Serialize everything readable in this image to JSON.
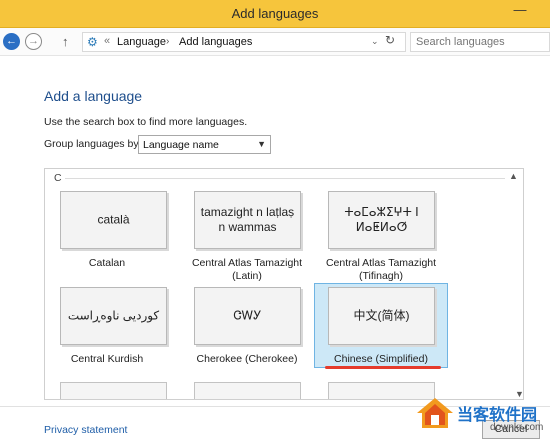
{
  "window": {
    "title": "Add languages",
    "minimize_glyph": "—"
  },
  "address_bar": {
    "back_glyph": "←",
    "forward_glyph": "→",
    "up_glyph": "↑",
    "separator": "«",
    "breadcrumbs": [
      "Language",
      "Add languages"
    ],
    "crumb_arrow": "›",
    "dropdown_glyph": "⌄",
    "refresh_glyph": "↻",
    "search_placeholder": "Search languages"
  },
  "content": {
    "heading": "Add a language",
    "hint": "Use the search box to find more languages.",
    "group_label": "Group languages by:",
    "group_value": "Language name",
    "section_letter": "C"
  },
  "languages": [
    {
      "native": "català",
      "name": "Catalan",
      "selected": false
    },
    {
      "native": "tamazight n laṭlaṣ n wammas",
      "name": "Central Atlas Tamazight (Latin)",
      "selected": false
    },
    {
      "native": "ⵜⴰⵎⴰⵣⵉⵖⵜ ⵏ ⵍⴰⵟⵍⴰⵚ",
      "name": "Central Atlas Tamazight (Tifinagh)",
      "selected": false
    },
    {
      "native": "کوردیی ناوەڕاست",
      "name": "Central Kurdish",
      "selected": false
    },
    {
      "native": "ᏣᎳᎩ",
      "name": "Cherokee (Cherokee)",
      "selected": false
    },
    {
      "native": "中文(简体)",
      "name": "Chinese (Simplified)",
      "selected": true
    }
  ],
  "footer": {
    "privacy": "Privacy statement",
    "cancel": "Cancel"
  },
  "watermark": {
    "text": "当客软件园",
    "url": "downkr.com"
  },
  "colors": {
    "titlebar": "#f6c53c",
    "accent": "#1e4e8c",
    "selection": "#cde8f7",
    "annotation": "#e53b2c"
  }
}
